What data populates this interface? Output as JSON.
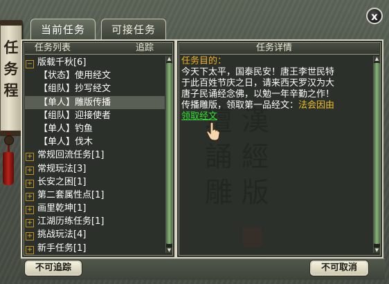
{
  "window": {
    "banner_chars": [
      "任",
      "务",
      "程"
    ],
    "close_label": "x"
  },
  "tabs": [
    {
      "label": "当前任务",
      "active": true
    },
    {
      "label": "可接任务",
      "active": false
    }
  ],
  "left_panel": {
    "header_title": "任务列表",
    "header_track": "追踪",
    "rows": [
      {
        "type": "group",
        "expanded": true,
        "label": "版载千秋[6]"
      },
      {
        "type": "item",
        "label": "【状态】使用经文"
      },
      {
        "type": "item",
        "label": "【组队】抄写经文"
      },
      {
        "type": "item",
        "label": "【单人】雕版传播",
        "selected": true
      },
      {
        "type": "item",
        "label": "【组队】迎接使者"
      },
      {
        "type": "item",
        "label": "【单人】钓鱼"
      },
      {
        "type": "item",
        "label": "【单人】伐木"
      },
      {
        "type": "group",
        "expanded": false,
        "label": "常规回流任务[1]"
      },
      {
        "type": "group",
        "expanded": false,
        "label": "常规玩法[3]"
      },
      {
        "type": "group",
        "expanded": false,
        "label": "长安之困[1]"
      },
      {
        "type": "group",
        "expanded": false,
        "label": "第二套属性点[1]"
      },
      {
        "type": "group",
        "expanded": false,
        "label": "画里乾坤[1]"
      },
      {
        "type": "group",
        "expanded": false,
        "label": "江湖历练任务[1]"
      },
      {
        "type": "group",
        "expanded": false,
        "label": "挑战玩法[4]"
      },
      {
        "type": "group",
        "expanded": false,
        "label": "新手任务[1]"
      }
    ]
  },
  "right_panel": {
    "header_title": "任务详情",
    "objective_title": "任务目的：",
    "line1": "今天下太平，国泰民安！唐王李世民特",
    "line2": "于此百姓节庆之日，请来西天罗汉为大",
    "line3": "唐子民诵经念佛，以勉一年辛勤之作！",
    "line4_prefix": "传播雕版，领取第一品经文：",
    "line4_highlight": "法会因由",
    "link_text": "领取经文"
  },
  "buttons": {
    "untrack": "不可追踪",
    "cancel": "不可取消"
  },
  "colors": {
    "accent_gold": "#f0b020",
    "link_green": "#30e030",
    "panel_bg": "#2b302a"
  }
}
